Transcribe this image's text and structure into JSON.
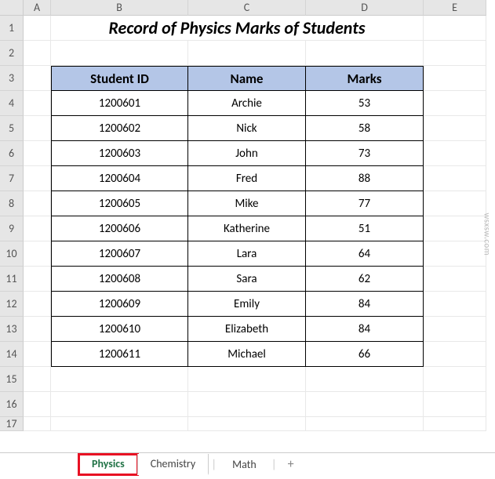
{
  "columns": [
    "A",
    "B",
    "C",
    "D",
    "E"
  ],
  "rows": [
    "1",
    "2",
    "3",
    "4",
    "5",
    "6",
    "7",
    "8",
    "9",
    "10",
    "11",
    "12",
    "13",
    "14",
    "15",
    "16",
    "17"
  ],
  "title": "Record of Physics Marks of Students",
  "table": {
    "headers": {
      "id": "Student ID",
      "name": "Name",
      "marks": "Marks"
    },
    "rows": [
      {
        "id": "1200601",
        "name": "Archie",
        "marks": "53"
      },
      {
        "id": "1200602",
        "name": "Nick",
        "marks": "58"
      },
      {
        "id": "1200603",
        "name": "John",
        "marks": "73"
      },
      {
        "id": "1200604",
        "name": "Fred",
        "marks": "88"
      },
      {
        "id": "1200605",
        "name": "Mike",
        "marks": "77"
      },
      {
        "id": "1200606",
        "name": "Katherine",
        "marks": "51"
      },
      {
        "id": "1200607",
        "name": "Lara",
        "marks": "64"
      },
      {
        "id": "1200608",
        "name": "Sara",
        "marks": "62"
      },
      {
        "id": "1200609",
        "name": "Emily",
        "marks": "84"
      },
      {
        "id": "1200610",
        "name": "Elizabeth",
        "marks": "84"
      },
      {
        "id": "1200611",
        "name": "Michael",
        "marks": "66"
      }
    ]
  },
  "tabs": {
    "active": "Physics",
    "items": [
      "Physics",
      "Chemistry",
      "Math"
    ],
    "add": "+"
  },
  "watermark": "wsxsw.com"
}
